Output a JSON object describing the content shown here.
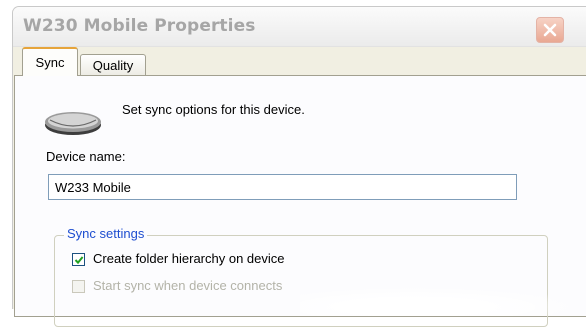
{
  "window": {
    "title": "W230 Mobile Properties"
  },
  "tabs": [
    {
      "label": "Sync",
      "selected": true
    },
    {
      "label": "Quality",
      "selected": false
    }
  ],
  "header": {
    "description": "Set sync options for this device."
  },
  "device_name": {
    "label": "Device name:",
    "value": "W233 Mobile"
  },
  "sync_settings": {
    "title": "Sync settings",
    "options": [
      {
        "label": "Create folder hierarchy on device",
        "checked": true,
        "enabled": true
      },
      {
        "label": "Start sync when device connects",
        "checked": false,
        "enabled": false
      }
    ]
  },
  "icons": {
    "device": "portable-device-icon",
    "close": "close-icon",
    "check": "checkmark-icon"
  },
  "colors": {
    "accent_tab": "#e6a43a",
    "group_title": "#1e4ed0",
    "close_button": "#e9a893"
  }
}
